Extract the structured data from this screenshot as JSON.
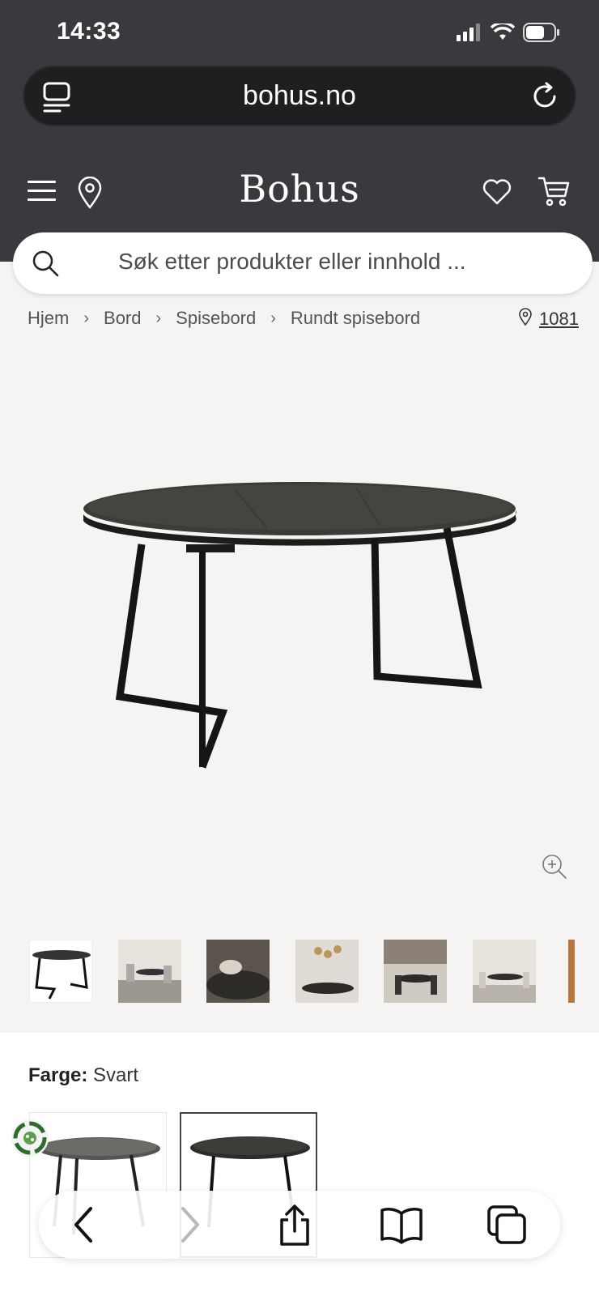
{
  "status_bar": {
    "time": "14:33"
  },
  "browser": {
    "url": "bohus.no"
  },
  "header": {
    "logo": "Bohus"
  },
  "search": {
    "placeholder": "Søk etter produkter eller innhold ..."
  },
  "breadcrumb": [
    "Hjem",
    "Bord",
    "Spisebord",
    "Rundt spisebord"
  ],
  "location": {
    "postal_code": "1081"
  },
  "thumbnails_count": 7,
  "color": {
    "label": "Farge:",
    "value": "Svart"
  },
  "colors": {
    "dark": "#3a393e",
    "surface": "#f6f4f2"
  }
}
